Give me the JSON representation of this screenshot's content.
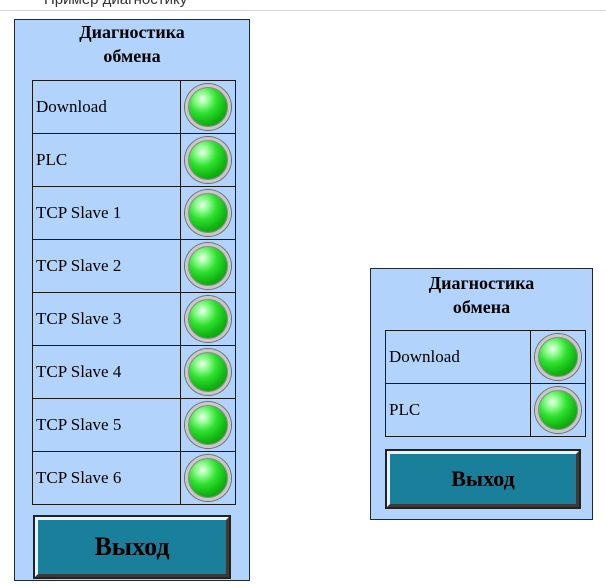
{
  "caption": {
    "text": "Пример диагностику"
  },
  "large_panel": {
    "title_line1": "Диагностика",
    "title_line2": "обмена",
    "rows": [
      {
        "label": "Download",
        "status": "ok"
      },
      {
        "label": "PLC",
        "status": "ok"
      },
      {
        "label": "TCP Slave 1",
        "status": "ok"
      },
      {
        "label": "TCP Slave 2",
        "status": "ok"
      },
      {
        "label": "TCP Slave 3",
        "status": "ok"
      },
      {
        "label": "TCP Slave 4",
        "status": "ok"
      },
      {
        "label": "TCP Slave 5",
        "status": "ok"
      },
      {
        "label": "TCP Slave 6",
        "status": "ok"
      }
    ],
    "exit_label": "Выход"
  },
  "small_panel": {
    "title_line1": "Диагностика",
    "title_line2": "обмена",
    "rows": [
      {
        "label": "Download",
        "status": "ok"
      },
      {
        "label": "PLC",
        "status": "ok"
      }
    ],
    "exit_label": "Выход"
  },
  "colors": {
    "panel_background": "#b2d3fb",
    "lamp_ok": "#2fe02f",
    "button_background": "#1a7f9a"
  },
  "icons": {
    "status_lamp": "green-led-icon"
  }
}
